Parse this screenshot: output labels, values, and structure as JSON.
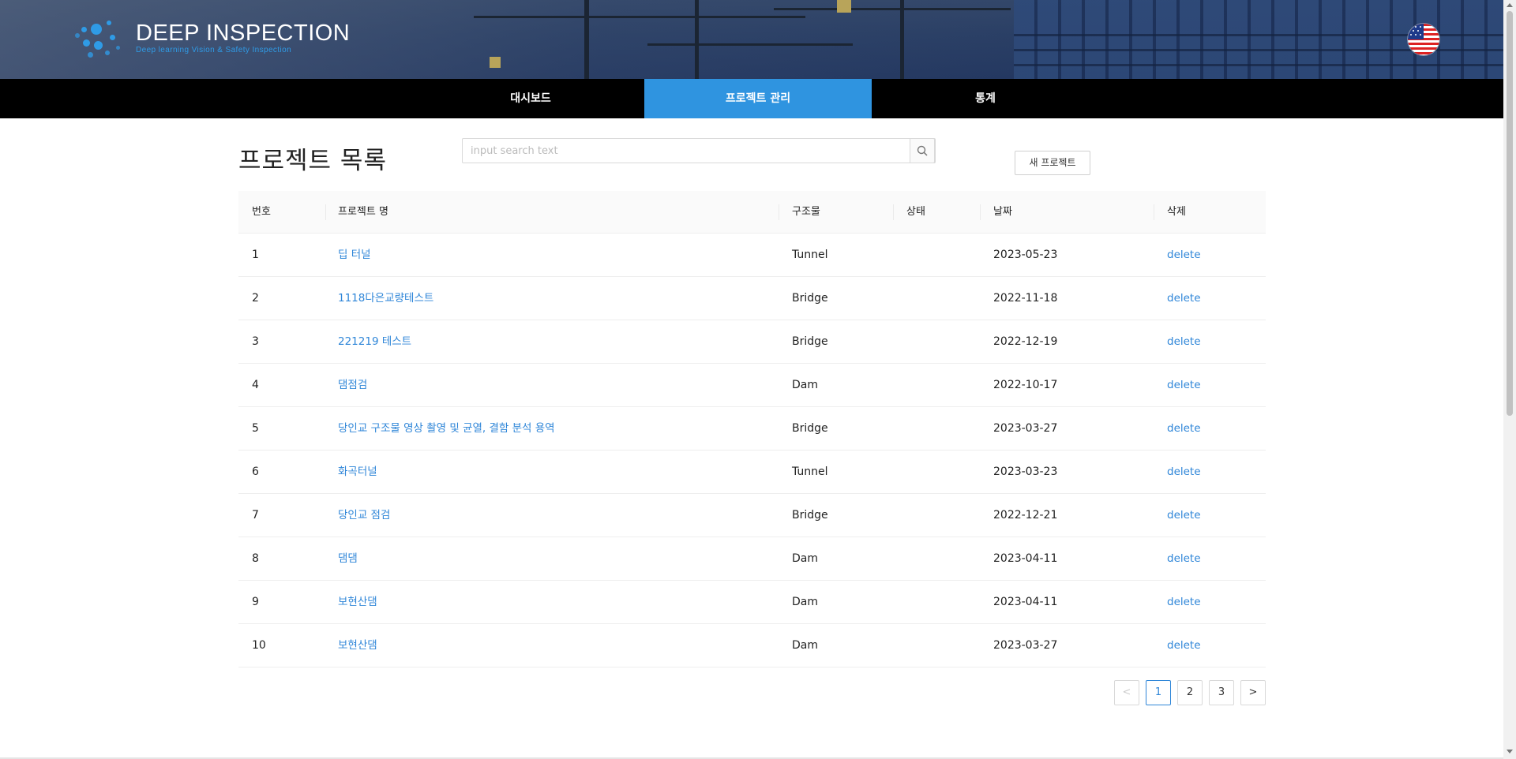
{
  "header": {
    "logo_title": "DEEP INSPECTION",
    "logo_subtitle": "Deep learning Vision & Safety Inspection",
    "language_icon": "us-flag-icon"
  },
  "nav": {
    "tabs": [
      {
        "label": "대시보드"
      },
      {
        "label": "프로젝트 관리",
        "active": true
      },
      {
        "label": "통계"
      }
    ]
  },
  "main": {
    "title": "프로젝트  목록",
    "search": {
      "placeholder": "input search text",
      "value": "",
      "icon": "search-icon"
    },
    "new_button_label": "새 프로젝트"
  },
  "table": {
    "columns": [
      "번호",
      "프로젝트 명",
      "구조물",
      "상태",
      "날짜",
      "삭제"
    ],
    "rows": [
      {
        "no": "1",
        "name": "딥 터널",
        "structure": "Tunnel",
        "status": "",
        "date": "2023-05-23",
        "action": "delete"
      },
      {
        "no": "2",
        "name": "1118다은교량테스트",
        "structure": "Bridge",
        "status": "",
        "date": "2022-11-18",
        "action": "delete"
      },
      {
        "no": "3",
        "name": "221219 테스트",
        "structure": "Bridge",
        "status": "",
        "date": "2022-12-19",
        "action": "delete"
      },
      {
        "no": "4",
        "name": "댐점검",
        "structure": "Dam",
        "status": "",
        "date": "2022-10-17",
        "action": "delete"
      },
      {
        "no": "5",
        "name": "당인교 구조물 영상 촬영 및 균열, 결함 분석 용역",
        "structure": "Bridge",
        "status": "",
        "date": "2023-03-27",
        "action": "delete"
      },
      {
        "no": "6",
        "name": "화곡터널",
        "structure": "Tunnel",
        "status": "",
        "date": "2023-03-23",
        "action": "delete"
      },
      {
        "no": "7",
        "name": "당인교 점검",
        "structure": "Bridge",
        "status": "",
        "date": "2022-12-21",
        "action": "delete"
      },
      {
        "no": "8",
        "name": "댐댐",
        "structure": "Dam",
        "status": "",
        "date": "2023-04-11",
        "action": "delete"
      },
      {
        "no": "9",
        "name": "보현산댐",
        "structure": "Dam",
        "status": "",
        "date": "2023-04-11",
        "action": "delete"
      },
      {
        "no": "10",
        "name": "보현산댐",
        "structure": "Dam",
        "status": "",
        "date": "2023-03-27",
        "action": "delete"
      }
    ]
  },
  "pagination": {
    "prev": "<",
    "pages": [
      "1",
      "2",
      "3"
    ],
    "current": "1",
    "next": ">"
  },
  "colors": {
    "accent": "#2f94e0",
    "link": "#2f86d8",
    "nav_bg": "#000000"
  }
}
